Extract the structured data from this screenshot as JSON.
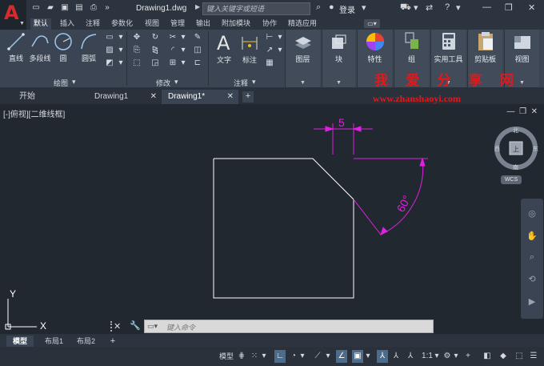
{
  "titlebar": {
    "filename": "Drawing1.dwg",
    "search_placeholder": "键入关键字或短语",
    "login": "登录"
  },
  "ribbon_tabs": [
    "默认",
    "插入",
    "注释",
    "参数化",
    "视图",
    "管理",
    "输出",
    "附加模块",
    "协作",
    "精选应用"
  ],
  "ribbon": {
    "draw": {
      "line": "直线",
      "polyline": "多段线",
      "circle": "圆",
      "arc": "圆弧",
      "panel": "绘图"
    },
    "modify": {
      "panel": "修改"
    },
    "annotation": {
      "text": "文字",
      "dimension": "标注",
      "panel": "注释"
    },
    "layers": "图层",
    "block": "块",
    "properties": "特性",
    "groups": "组",
    "utilities": "实用工具",
    "clipboard": "剪贴板",
    "view": "视图"
  },
  "doc_tabs": [
    "开始",
    "Drawing1",
    "Drawing1*"
  ],
  "viewport": {
    "label": "[-]俯视][二维线框]",
    "dimension_linear": "5",
    "dimension_angular": "60°",
    "ucs_y": "Y",
    "ucs_x": "X"
  },
  "watermark": {
    "line1": "我 爱 分 享 网",
    "line2": "www.zhanshaoyi.com"
  },
  "viewcube": {
    "north": "北",
    "south": "南",
    "east": "东",
    "west": "西",
    "top": "上",
    "wcs": "WCS"
  },
  "command_line": {
    "placeholder": "键入命令"
  },
  "layout_tabs": [
    "模型",
    "布局1",
    "布局2"
  ],
  "status": {
    "model": "模型",
    "scale": "1:1"
  },
  "colors": {
    "accent": "#d72b2b",
    "dimension": "#e020e0",
    "geometry": "#ffffff",
    "watermark": "#e4181b",
    "canvas_bg": "#212830"
  }
}
